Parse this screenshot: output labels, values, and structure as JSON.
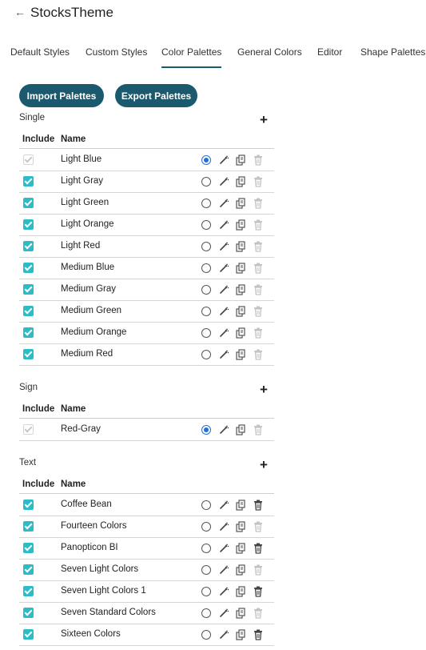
{
  "header": {
    "back_glyph": "←",
    "title": "StocksTheme"
  },
  "tabs": [
    {
      "label": "Default Styles",
      "active": false
    },
    {
      "label": "Custom Styles",
      "active": false
    },
    {
      "label": "Color Palettes",
      "active": true
    },
    {
      "label": "General Colors",
      "active": false
    },
    {
      "label": "Editor",
      "active": false
    },
    {
      "label": "Shape Palettes",
      "active": false
    }
  ],
  "actions": {
    "import_label": "Import Palettes",
    "export_label": "Export Palettes"
  },
  "table_headers": {
    "include": "Include",
    "name": "Name"
  },
  "icons": {
    "add": "plus-icon",
    "edit": "pencil-icon",
    "copy": "copy-icon",
    "delete": "trash-icon"
  },
  "colors": {
    "accent": "#1b5a6e",
    "checkbox": "#2bbcc8",
    "radio_selected": "#1f6fd6",
    "trash_enabled": "#444444",
    "trash_disabled": "#c4c4c4"
  },
  "sections": [
    {
      "title": "Single",
      "rows": [
        {
          "name": "Light Blue",
          "included": true,
          "include_disabled": true,
          "default": true,
          "deletable": false
        },
        {
          "name": "Light Gray",
          "included": true,
          "include_disabled": false,
          "default": false,
          "deletable": false
        },
        {
          "name": "Light Green",
          "included": true,
          "include_disabled": false,
          "default": false,
          "deletable": false
        },
        {
          "name": "Light Orange",
          "included": true,
          "include_disabled": false,
          "default": false,
          "deletable": false
        },
        {
          "name": "Light Red",
          "included": true,
          "include_disabled": false,
          "default": false,
          "deletable": false
        },
        {
          "name": "Medium Blue",
          "included": true,
          "include_disabled": false,
          "default": false,
          "deletable": false
        },
        {
          "name": "Medium Gray",
          "included": true,
          "include_disabled": false,
          "default": false,
          "deletable": false
        },
        {
          "name": "Medium Green",
          "included": true,
          "include_disabled": false,
          "default": false,
          "deletable": false
        },
        {
          "name": "Medium Orange",
          "included": true,
          "include_disabled": false,
          "default": false,
          "deletable": false
        },
        {
          "name": "Medium Red",
          "included": true,
          "include_disabled": false,
          "default": false,
          "deletable": false
        }
      ]
    },
    {
      "title": "Sign",
      "rows": [
        {
          "name": "Red-Gray",
          "included": true,
          "include_disabled": true,
          "default": true,
          "deletable": false
        }
      ]
    },
    {
      "title": "Text",
      "rows": [
        {
          "name": "Coffee Bean",
          "included": true,
          "include_disabled": false,
          "default": false,
          "deletable": true
        },
        {
          "name": "Fourteen Colors",
          "included": true,
          "include_disabled": false,
          "default": false,
          "deletable": false
        },
        {
          "name": "Panopticon BI",
          "included": true,
          "include_disabled": false,
          "default": false,
          "deletable": true
        },
        {
          "name": "Seven Light Colors",
          "included": true,
          "include_disabled": false,
          "default": false,
          "deletable": false
        },
        {
          "name": "Seven Light Colors 1",
          "included": true,
          "include_disabled": false,
          "default": false,
          "deletable": true
        },
        {
          "name": "Seven Standard Colors",
          "included": true,
          "include_disabled": false,
          "default": false,
          "deletable": false
        },
        {
          "name": "Sixteen Colors",
          "included": true,
          "include_disabled": false,
          "default": false,
          "deletable": true
        }
      ]
    }
  ]
}
